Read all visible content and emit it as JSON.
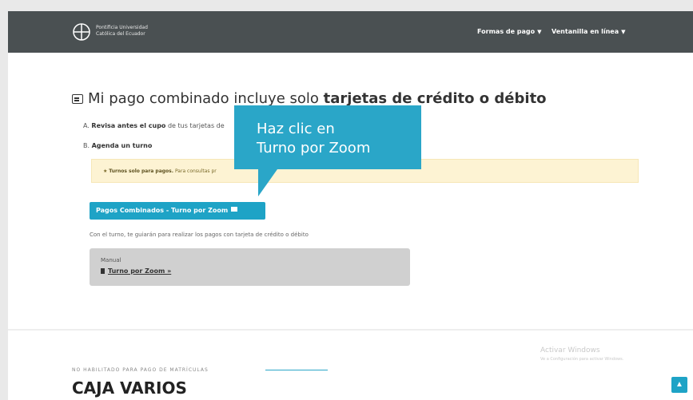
{
  "header": {
    "logo_text": "Pontificia Universidad Católica del Ecuador",
    "nav": [
      {
        "label": "Formas de pago"
      },
      {
        "label": "Ventanilla en línea"
      }
    ]
  },
  "main": {
    "title_prefix": "Mi pago combinado incluye solo",
    "title_bold": "tarjetas de crédito o débito",
    "step_a_prefix": "A.",
    "step_a_bold": "Revisa antes el cupo",
    "step_a_rest": "de tus tarjetas de",
    "step_b_prefix": "B.",
    "step_b_bold": "Agenda un turno",
    "alert_bold": "Turnos solo para pagos.",
    "alert_text": "Para consultas pr",
    "zoom_button": "Pagos Combinados - Turno por Zoom",
    "note": "Con el turno, te guiarán para realizar los pagos con tarjeta de crédito o débito",
    "manual_label": "Manual",
    "manual_link": "Turno por Zoom »"
  },
  "callout": {
    "line1": "Haz clic en",
    "line2": "Turno por Zoom"
  },
  "footer_section": {
    "kicker": "NO HABILITADO PARA PAGO DE MATRÍCULAS",
    "title": "CAJA VARIOS"
  },
  "watermark": {
    "line1": "Activar Windows",
    "line2": "Ve a Configuración para activar Windows."
  },
  "colors": {
    "navbar": "#4a5052",
    "accent": "#1ea3c6",
    "callout": "#2aa6c8",
    "alert_bg": "#fdf3d3"
  }
}
